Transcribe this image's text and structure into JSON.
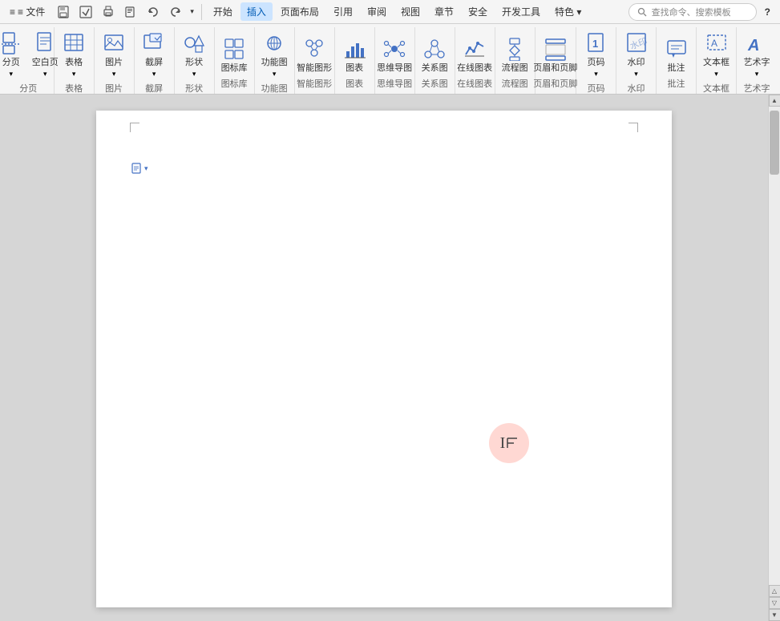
{
  "menubar": {
    "items": [
      {
        "id": "file",
        "label": "≡ 文件",
        "active": false
      },
      {
        "id": "save",
        "label": "💾",
        "active": false,
        "icon": true
      },
      {
        "id": "undo-save",
        "label": "🖫",
        "active": false,
        "icon": true
      },
      {
        "id": "print",
        "label": "🖨",
        "active": false,
        "icon": true
      },
      {
        "id": "print2",
        "label": "⎙",
        "active": false,
        "icon": true
      },
      {
        "id": "undo",
        "label": "↩",
        "active": false,
        "icon": true
      },
      {
        "id": "redo",
        "label": "↪",
        "active": false,
        "icon": true
      },
      {
        "id": "more-undo",
        "label": "▾",
        "active": false,
        "icon": true
      },
      {
        "id": "kaishi",
        "label": "开始",
        "active": false
      },
      {
        "id": "charu",
        "label": "插入",
        "active": true
      },
      {
        "id": "yemian",
        "label": "页面布局",
        "active": false
      },
      {
        "id": "yinyong",
        "label": "引用",
        "active": false
      },
      {
        "id": "shenpi",
        "label": "审阅",
        "active": false
      },
      {
        "id": "shitu",
        "label": "视图",
        "active": false
      },
      {
        "id": "zhangje",
        "label": "章节",
        "active": false
      },
      {
        "id": "anquan",
        "label": "安全",
        "active": false
      },
      {
        "id": "kaifa",
        "label": "开发工具",
        "active": false
      },
      {
        "id": "tese",
        "label": "特色 ▾",
        "active": false
      },
      {
        "id": "search",
        "label": "🔍查找命令、搜索模板",
        "active": false
      },
      {
        "id": "help",
        "label": "?",
        "active": false
      }
    ]
  },
  "ribbon": {
    "groups": [
      {
        "id": "fenyemian",
        "label": "分页",
        "buttons": [
          {
            "id": "fenyemian-btn",
            "label": "分页\n▾",
            "icon": "page-break"
          },
          {
            "id": "kongbai-btn",
            "label": "空白页\n▾",
            "icon": "blank-page"
          }
        ]
      },
      {
        "id": "biaoge",
        "label": "表格",
        "buttons": [
          {
            "id": "biaoge-btn",
            "label": "表格\n▾",
            "icon": "table"
          }
        ]
      },
      {
        "id": "tupian",
        "label": "图片",
        "buttons": [
          {
            "id": "tupian-btn",
            "label": "图片\n▾",
            "icon": "image"
          }
        ]
      },
      {
        "id": "jieping",
        "label": "截屏",
        "buttons": [
          {
            "id": "jieping-btn",
            "label": "截屏\n▾",
            "icon": "screenshot"
          }
        ]
      },
      {
        "id": "xingzhuang",
        "label": "形状",
        "buttons": [
          {
            "id": "xingzhuang-btn",
            "label": "形状\n▾",
            "icon": "shapes"
          }
        ]
      },
      {
        "id": "tubiaoku",
        "label": "图标库",
        "buttons": [
          {
            "id": "tubiaoku-btn",
            "label": "图标库",
            "icon": "icon-library"
          }
        ]
      },
      {
        "id": "gongnengtu",
        "label": "功能图",
        "buttons": [
          {
            "id": "gongnengtu-btn",
            "label": "功能图\n▾",
            "icon": "func-chart"
          }
        ]
      },
      {
        "id": "smart",
        "label": "智能图形",
        "buttons": [
          {
            "id": "smart-btn",
            "label": "智能图形",
            "icon": "smart-art"
          }
        ]
      },
      {
        "id": "biaootu",
        "label": "图表",
        "buttons": [
          {
            "id": "biaotu-btn",
            "label": "图表",
            "icon": "chart"
          }
        ]
      },
      {
        "id": "siweidaotu",
        "label": "思维导图",
        "buttons": [
          {
            "id": "siweidaotu-btn",
            "label": "思维导图",
            "icon": "mindmap"
          }
        ]
      },
      {
        "id": "guanxitu",
        "label": "关系图",
        "buttons": [
          {
            "id": "guanxitu-btn",
            "label": "关系图",
            "icon": "relation"
          }
        ]
      },
      {
        "id": "onlinechart",
        "label": "在线图表",
        "buttons": [
          {
            "id": "onlinechart-btn",
            "label": "在线图表",
            "icon": "online-chart"
          }
        ]
      },
      {
        "id": "liuchengtu",
        "label": "流程图",
        "buttons": [
          {
            "id": "liuchengtu-btn",
            "label": "流程图",
            "icon": "flowchart"
          }
        ]
      },
      {
        "id": "yemei",
        "label": "页眉和页脚",
        "buttons": [
          {
            "id": "yemei-btn",
            "label": "页眉和页脚",
            "icon": "header-footer"
          }
        ]
      },
      {
        "id": "yema",
        "label": "页码",
        "buttons": [
          {
            "id": "yema-btn",
            "label": "页码\n▾",
            "icon": "page-num"
          }
        ]
      },
      {
        "id": "shuiyin",
        "label": "水印",
        "buttons": [
          {
            "id": "shuiyin-btn",
            "label": "水印\n▾",
            "icon": "watermark"
          }
        ]
      },
      {
        "id": "pizhu",
        "label": "批注",
        "buttons": [
          {
            "id": "pizhu-btn",
            "label": "批注",
            "icon": "comment"
          }
        ]
      },
      {
        "id": "wenbenkuang",
        "label": "文本框",
        "buttons": [
          {
            "id": "wenbenkuang-btn",
            "label": "文本框\n▾",
            "icon": "textbox"
          }
        ]
      },
      {
        "id": "yishuzhi",
        "label": "艺术字",
        "buttons": [
          {
            "id": "yishuzhi-btn",
            "label": "艺术字\n▾",
            "icon": "wordart"
          }
        ]
      }
    ]
  },
  "document": {
    "page_bg": "#ffffff",
    "cursor_visible": true
  },
  "scrollbar": {
    "up_arrow": "▲",
    "down_arrow": "▼",
    "page_up": "△",
    "page_down": "▽"
  }
}
